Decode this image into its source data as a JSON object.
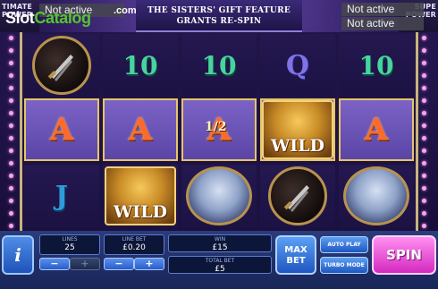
{
  "top_bar": {
    "left_label": "TIMATE POWER",
    "right_label": "SUPE POWER",
    "status_left": "Not active",
    "status_right_top": "Not active",
    "status_right_bottom": "Not active",
    "banner_line1": "THE SISTERS' GIFT FEATURE",
    "banner_line2": "GRANTS RE-SPIN"
  },
  "watermark": {
    "slot": "Slot",
    "catalog": "Catalog",
    "com": ".com"
  },
  "reels": {
    "row1": [
      "sword-icon",
      "10",
      "10",
      "Q",
      "10"
    ],
    "row2": [
      "A",
      "A",
      "A",
      "WILD",
      "A"
    ],
    "row3": [
      "J",
      "WILD",
      "portrait-icon",
      "sword-icon",
      "portrait-icon"
    ],
    "multiplier": "1/2"
  },
  "controls": {
    "info_label": "i",
    "lines_label": "LINES",
    "lines_value": "25",
    "line_bet_label": "LINE BET",
    "line_bet_value": "£0.20",
    "win_label": "WIN",
    "win_value": "£15",
    "total_bet_label": "TOTAL BET",
    "total_bet_value": "£5",
    "minus": "−",
    "plus": "+",
    "max_bet_line1": "MAX",
    "max_bet_line2": "BET",
    "auto_play": "AUTO PLAY",
    "turbo_mode": "TURBO MODE",
    "spin": "SPIN"
  },
  "colors": {
    "accent_gold": "#e5c56a",
    "spin_pink": "#d42ac0",
    "watermark_green": "#56c42f"
  }
}
